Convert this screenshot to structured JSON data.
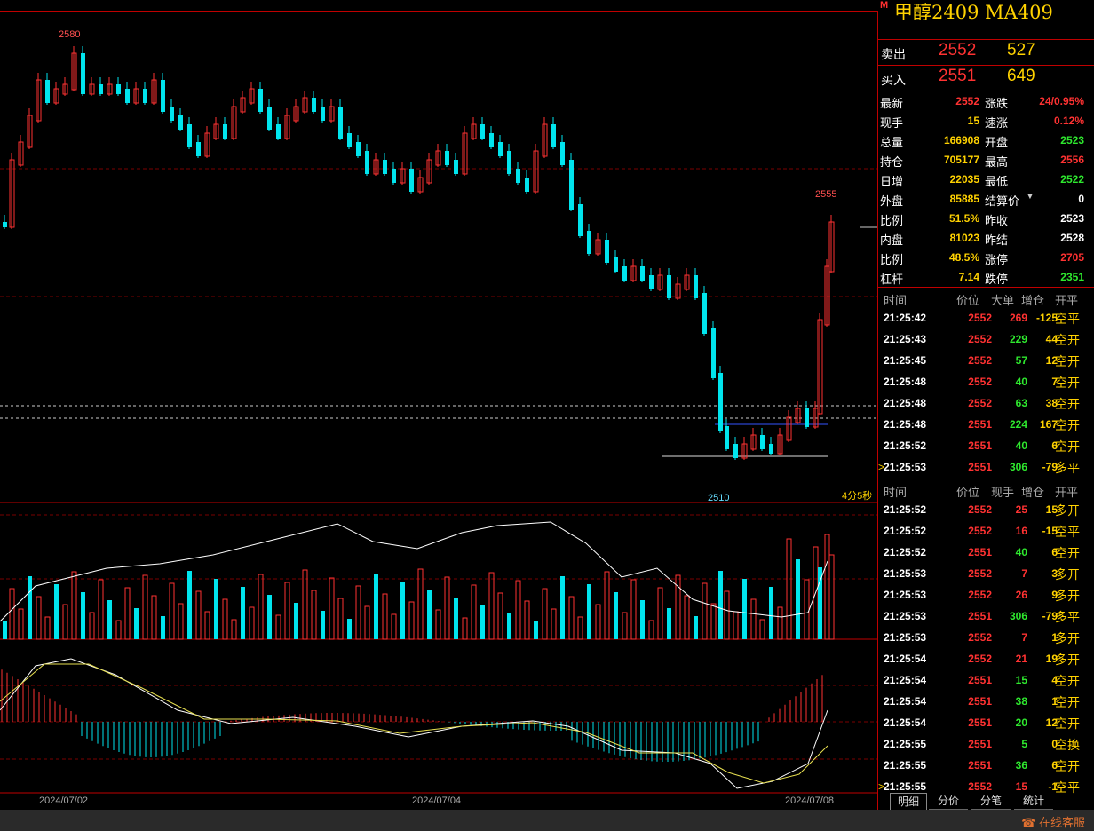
{
  "title": "甲醇2409  MA409",
  "market_badge": "M",
  "quotes": [
    {
      "label": "卖出",
      "price": "2552",
      "volume": "527"
    },
    {
      "label": "买入",
      "price": "2551",
      "volume": "649"
    }
  ],
  "stats_left": [
    {
      "k": "最新",
      "v": "2552",
      "c": "red"
    },
    {
      "k": "现手",
      "v": "15",
      "c": "yel"
    },
    {
      "k": "总量",
      "v": "166908",
      "c": "yel"
    },
    {
      "k": "持仓",
      "v": "705177",
      "c": "yel"
    },
    {
      "k": "日增",
      "v": "22035",
      "c": "yel"
    },
    {
      "k": "外盘",
      "v": "85885",
      "c": "yel"
    },
    {
      "k": "比例",
      "v": "51.5%",
      "c": "yel"
    },
    {
      "k": "内盘",
      "v": "81023",
      "c": "yel"
    },
    {
      "k": "比例",
      "v": "48.5%",
      "c": "yel"
    },
    {
      "k": "杠杆",
      "v": "7.14",
      "c": "yel"
    }
  ],
  "stats_right": [
    {
      "k": "涨跌",
      "v": "24/0.95%",
      "c": "red"
    },
    {
      "k": "速涨",
      "v": "0.12%",
      "c": "red"
    },
    {
      "k": "开盘",
      "v": "2523",
      "c": "green"
    },
    {
      "k": "最高",
      "v": "2556",
      "c": "red"
    },
    {
      "k": "最低",
      "v": "2522",
      "c": "green"
    },
    {
      "k": "结算价",
      "v": "0",
      "c": "wht"
    },
    {
      "k": "昨收",
      "v": "2523",
      "c": "wht"
    },
    {
      "k": "昨结",
      "v": "2528",
      "c": "wht"
    },
    {
      "k": "涨停",
      "v": "2705",
      "c": "red"
    },
    {
      "k": "跌停",
      "v": "2351",
      "c": "green"
    }
  ],
  "big_orders": {
    "headers": [
      "时间",
      "价位",
      "大单",
      "增仓",
      "开平"
    ],
    "rows": [
      {
        "t": "21:25:42",
        "p": "2552",
        "q": "269",
        "qc": "red",
        "d": "-125",
        "ty": "空平",
        "mark": ""
      },
      {
        "t": "21:25:43",
        "p": "2552",
        "q": "229",
        "qc": "green",
        "d": "44",
        "ty": "空开",
        "mark": ""
      },
      {
        "t": "21:25:45",
        "p": "2552",
        "q": "57",
        "qc": "green",
        "d": "12",
        "ty": "空开",
        "mark": ""
      },
      {
        "t": "21:25:48",
        "p": "2552",
        "q": "40",
        "qc": "green",
        "d": "7",
        "ty": "空开",
        "mark": ""
      },
      {
        "t": "21:25:48",
        "p": "2552",
        "q": "63",
        "qc": "green",
        "d": "38",
        "ty": "空开",
        "mark": ""
      },
      {
        "t": "21:25:48",
        "p": "2551",
        "q": "224",
        "qc": "green",
        "d": "167",
        "ty": "空开",
        "mark": ""
      },
      {
        "t": "21:25:52",
        "p": "2551",
        "q": "40",
        "qc": "green",
        "d": "6",
        "ty": "空开",
        "mark": ""
      },
      {
        "t": "21:25:53",
        "p": "2551",
        "q": "306",
        "qc": "green",
        "d": "-79",
        "ty": "多平",
        "mark": ">"
      }
    ]
  },
  "ticks": {
    "headers": [
      "时间",
      "价位",
      "现手",
      "增仓",
      "开平"
    ],
    "rows": [
      {
        "t": "21:25:52",
        "p": "2552",
        "q": "25",
        "qc": "red",
        "d": "15",
        "ty": "多开",
        "mark": ""
      },
      {
        "t": "21:25:52",
        "p": "2552",
        "q": "16",
        "qc": "red",
        "d": "-15",
        "ty": "空平",
        "mark": ""
      },
      {
        "t": "21:25:52",
        "p": "2551",
        "q": "40",
        "qc": "green",
        "d": "6",
        "ty": "空开",
        "mark": ""
      },
      {
        "t": "21:25:53",
        "p": "2552",
        "q": "7",
        "qc": "red",
        "d": "3",
        "ty": "多开",
        "mark": ""
      },
      {
        "t": "21:25:53",
        "p": "2552",
        "q": "26",
        "qc": "red",
        "d": "9",
        "ty": "多开",
        "mark": ""
      },
      {
        "t": "21:25:53",
        "p": "2551",
        "q": "306",
        "qc": "green",
        "d": "-79",
        "ty": "多平",
        "mark": ""
      },
      {
        "t": "21:25:53",
        "p": "2552",
        "q": "7",
        "qc": "red",
        "d": "1",
        "ty": "多开",
        "mark": ""
      },
      {
        "t": "21:25:54",
        "p": "2552",
        "q": "21",
        "qc": "red",
        "d": "19",
        "ty": "多开",
        "mark": ""
      },
      {
        "t": "21:25:54",
        "p": "2551",
        "q": "15",
        "qc": "green",
        "d": "4",
        "ty": "空开",
        "mark": ""
      },
      {
        "t": "21:25:54",
        "p": "2551",
        "q": "38",
        "qc": "green",
        "d": "1",
        "ty": "空开",
        "mark": ""
      },
      {
        "t": "21:25:54",
        "p": "2551",
        "q": "20",
        "qc": "green",
        "d": "12",
        "ty": "空开",
        "mark": ""
      },
      {
        "t": "21:25:55",
        "p": "2551",
        "q": "5",
        "qc": "green",
        "d": "0",
        "ty": "空换",
        "mark": ""
      },
      {
        "t": "21:25:55",
        "p": "2551",
        "q": "36",
        "qc": "green",
        "d": "6",
        "ty": "空开",
        "mark": ""
      },
      {
        "t": "21:25:55",
        "p": "2552",
        "q": "15",
        "qc": "red",
        "d": "-1",
        "ty": "空平",
        "mark": ">"
      }
    ]
  },
  "tabs": [
    "明细",
    "分价",
    "分笔",
    "统计"
  ],
  "dates": [
    "2024/07/02",
    "2024/07/04",
    "2024/07/08"
  ],
  "chart_labels": {
    "high": "2580",
    "recent_high": "2555",
    "low": "2510",
    "period": "4分5秒"
  },
  "footer_service": "在线客服",
  "colors": {
    "up": "#ff3232",
    "down": "#00e5ee",
    "accent": "#c00000",
    "yellow": "#ffd200"
  }
}
